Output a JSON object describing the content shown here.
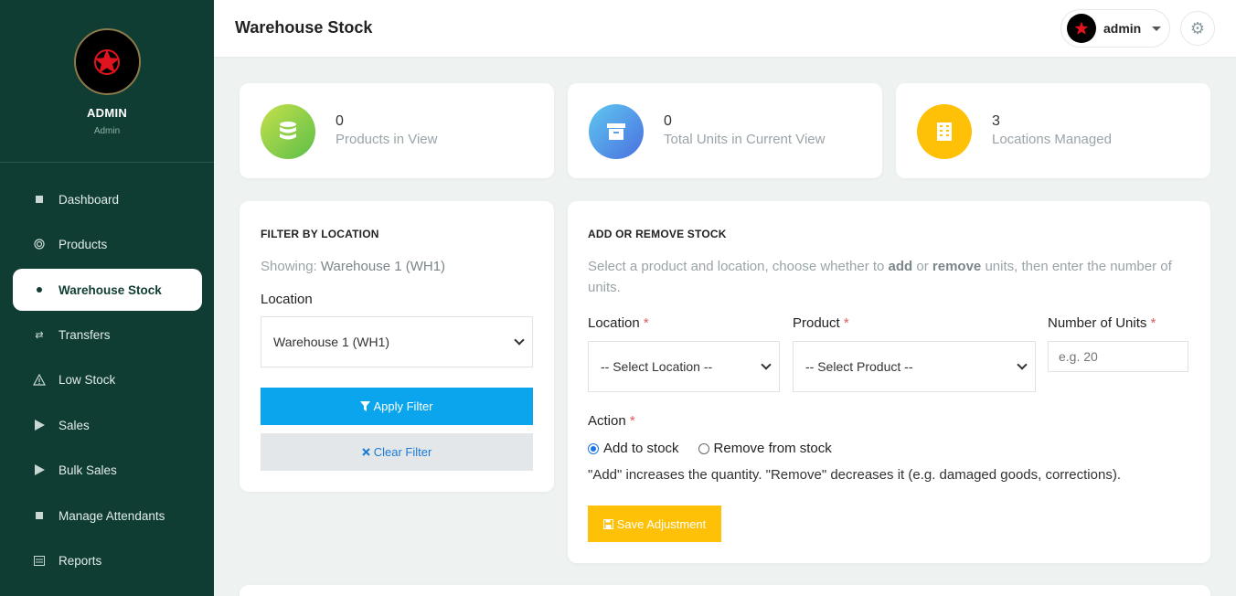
{
  "sidebar": {
    "profile_name": "ADMIN",
    "profile_role": "Admin",
    "items": [
      {
        "label": "Dashboard",
        "icon": "square-icon"
      },
      {
        "label": "Products",
        "icon": "target-icon"
      },
      {
        "label": "Warehouse Stock",
        "icon": "dot-icon",
        "active": true
      },
      {
        "label": "Transfers",
        "icon": "exchange-icon"
      },
      {
        "label": "Low Stock",
        "icon": "warning-icon"
      },
      {
        "label": "Sales",
        "icon": "play-icon"
      },
      {
        "label": "Bulk Sales",
        "icon": "play-icon"
      },
      {
        "label": "Manage Attendants",
        "icon": "square-icon"
      },
      {
        "label": "Reports",
        "icon": "list-icon"
      }
    ]
  },
  "header": {
    "title": "Warehouse Stock",
    "user": "admin"
  },
  "stats": [
    {
      "value": "0",
      "label": "Products in View",
      "icon": "database-icon",
      "color": "#8cc63f"
    },
    {
      "value": "0",
      "label": "Total Units in Current View",
      "icon": "archive-icon",
      "color": "#4a9eea"
    },
    {
      "value": "3",
      "label": "Locations Managed",
      "icon": "building-icon",
      "color": "#ffc107"
    }
  ],
  "filter": {
    "title": "FILTER BY LOCATION",
    "showing_prefix": "Showing:",
    "showing_value": "Warehouse 1 (WH1)",
    "location_label": "Location",
    "location_selected": "Warehouse 1 (WH1)",
    "apply_label": "Apply Filter",
    "clear_label": "Clear Filter"
  },
  "adjust": {
    "title": "ADD OR REMOVE STOCK",
    "desc_1": "Select a product and location, choose whether to",
    "desc_add": "add",
    "desc_or": "or",
    "desc_remove": "remove",
    "desc_2": "units, then enter the",
    "desc_3": "number of units.",
    "location_label": "Location",
    "location_selected": "-- Select Location --",
    "product_label": "Product",
    "product_selected": "-- Select Product --",
    "units_label": "Number of Units",
    "units_placeholder": "e.g. 20",
    "required_mark": "*",
    "action_label": "Action",
    "option_add": "Add to stock",
    "option_remove": "Remove from stock",
    "hint": "\"Add\" increases the quantity. \"Remove\" decreases it (e.g. damaged goods, corrections).",
    "save_label": "Save Adjustment"
  },
  "colors": {
    "sidebar_bg": "#0f3d33",
    "primary": "#0aa5ec",
    "warning": "#ffc107",
    "star": "#e0141e"
  }
}
